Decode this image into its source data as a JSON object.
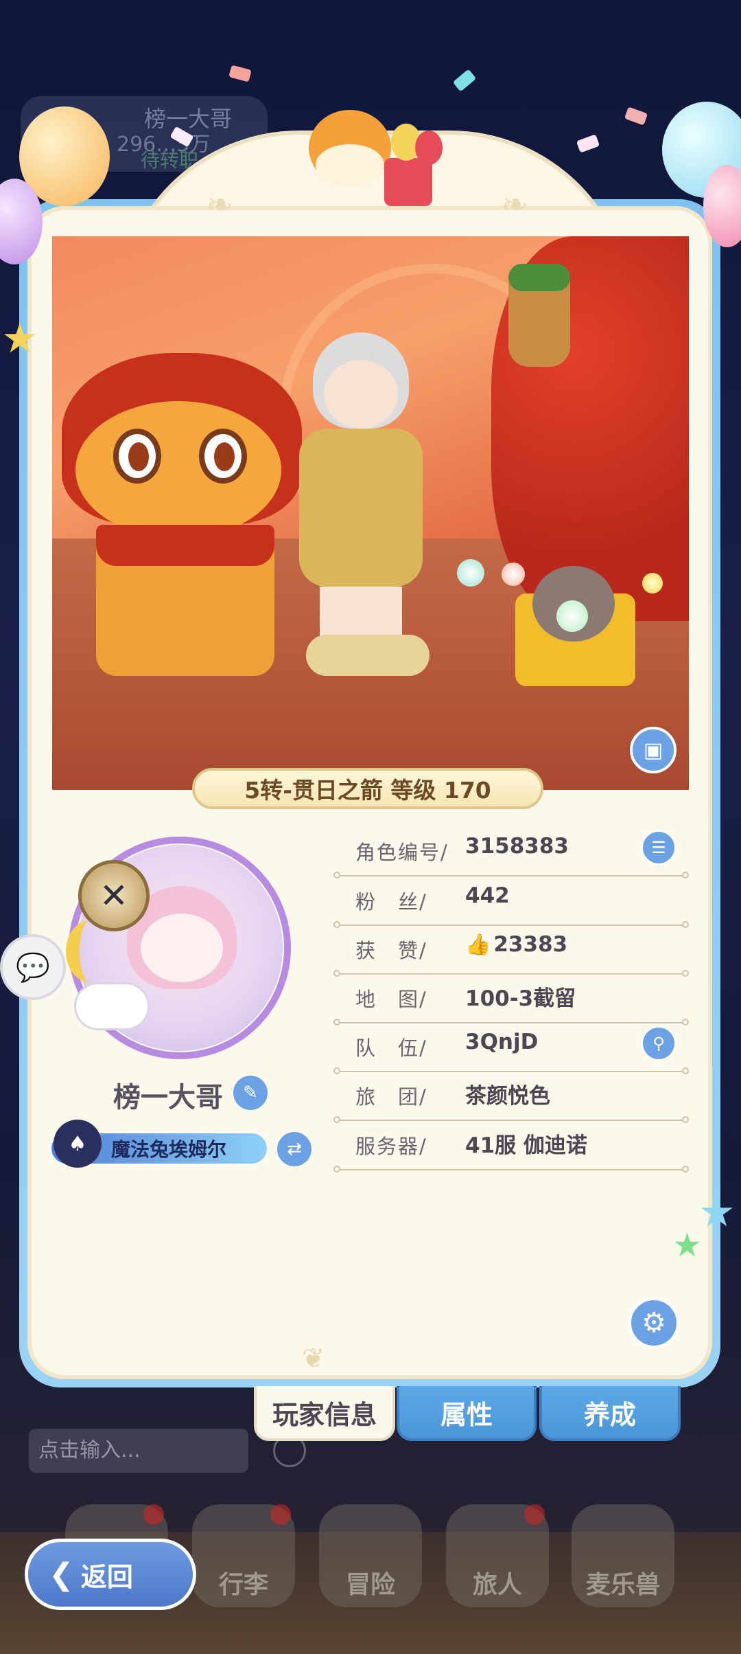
{
  "background": {
    "player_name": "榜一大哥",
    "power_text": "296…5万",
    "pending_text": "待转职",
    "chat_input_placeholder": "点击输入...",
    "nav_tabs": [
      {
        "label": ""
      },
      {
        "label": "行李"
      },
      {
        "label": "冒险"
      },
      {
        "label": "旅人"
      },
      {
        "label": "麦乐兽"
      }
    ]
  },
  "profile": {
    "title_plate": "5转-贯日之箭 等级 170",
    "player_name": "榜一大哥",
    "pet_name": "魔法兔埃姆尔",
    "rows": [
      {
        "label": "角色编号/",
        "value": "3158383",
        "has_button": true,
        "button_icon": "copy-icon"
      },
      {
        "label": "粉　丝/",
        "value": "442"
      },
      {
        "label": "获　赞/",
        "value": "23383",
        "icon": "thumbs-up-icon"
      },
      {
        "label": "地　图/",
        "value": "100-3截留"
      },
      {
        "label": "队　伍/",
        "value": "3QnjD",
        "has_button": true,
        "button_icon": "search-icon"
      },
      {
        "label": "旅　团/",
        "value": "茶颜悦色"
      },
      {
        "label": "服务器/",
        "value": "41服 伽迪诺"
      }
    ]
  },
  "tabs": {
    "player_info": "玩家信息",
    "attributes": "属性",
    "development": "养成"
  },
  "back_button": {
    "label": "返回"
  },
  "colors": {
    "accent_blue": "#6ca2e3",
    "card_bg": "#fdf8ec",
    "frame_blue": "#7fc2f0"
  }
}
